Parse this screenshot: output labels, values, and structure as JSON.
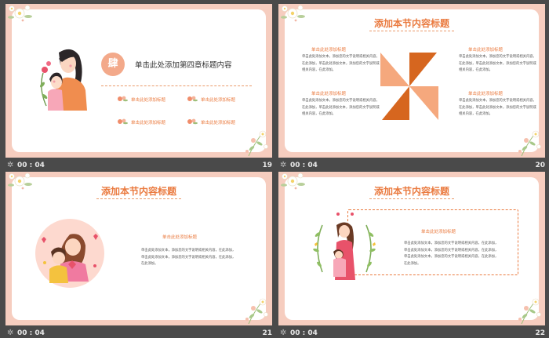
{
  "slides": [
    {
      "number": "19",
      "time": "00 : 04",
      "badge": "肆",
      "chapter_title": "单击此处添加第四章标题内容",
      "items": [
        "单击此处添加标题",
        "单击此处添加标题",
        "单击此处添加标题",
        "单击此处添加标题"
      ]
    },
    {
      "number": "20",
      "time": "00 : 04",
      "title": "添加本节内容标题",
      "blocks": [
        {
          "heading": "单击此处添加标题",
          "text": "单击此处添加文本，添加您的文字说明或相关内容，\n在此添加，单击此处添加文本，添加您的文字说明或\n相关内容，在此添加。"
        },
        {
          "heading": "单击此处添加标题",
          "text": "单击此处添加文本，添加您的文字说明或相关内容，\n在此添加，单击此处添加文本，添加您的文字说明或\n相关内容，在此添加。"
        },
        {
          "heading": "单击此处添加标题",
          "text": "单击此处添加文本，添加您的文字说明或相关内容，\n在此添加，单击此处添加文本，添加您的文字说明或\n相关内容，在此添加。"
        },
        {
          "heading": "单击此处添加标题",
          "text": "单击此处添加文本，添加您的文字说明或相关内容，\n在此添加，单击此处添加文本，添加您的文字说明或\n相关内容，在此添加。"
        }
      ],
      "colors": {
        "dark": "#d6661f",
        "light": "#f5a87d"
      }
    },
    {
      "number": "21",
      "time": "00 : 04",
      "title": "添加本节内容标题",
      "sub": "单击此处添加标题",
      "text": "单击此处添加文本，添加您的文字说明或相关内容，在此添加，\n单击此处添加文本，添加您的文字说明或相关内容，在此添加，\n在此添加。"
    },
    {
      "number": "22",
      "time": "00 : 04",
      "title": "添加本节内容标题",
      "sub": "单击此处添加标题",
      "text": "单击此处添加文本，添加您的文字说明或相关内容，在此添加，\n单击此处添加文本，添加您的文字说明或相关内容，在此添加，\n单击此处添加文本，添加您的文字说明或相关内容，在此添加，\n在此添加。"
    }
  ],
  "icons": {
    "footer": "slide-transition-icon",
    "flower": "flower-decoration-icon"
  },
  "colors": {
    "accent": "#ea7a3f",
    "frame": "#f6cdbf",
    "background": "#4a4a4a"
  }
}
